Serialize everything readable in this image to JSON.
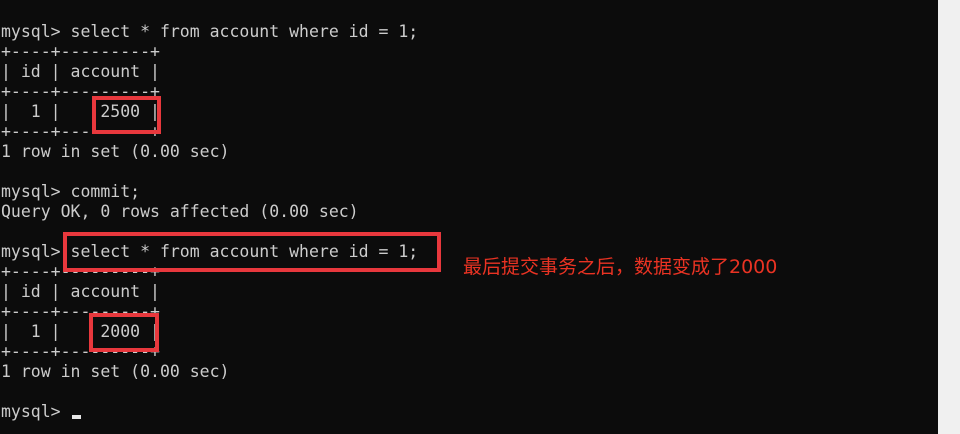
{
  "terminal": {
    "lines": [
      "mysql> select * from account where id = 1;",
      "+----+---------+",
      "| id | account |",
      "+----+---------+",
      "|  1 |    2500 |",
      "+----+---------+",
      "1 row in set (0.00 sec)",
      "",
      "mysql> commit;",
      "Query OK, 0 rows affected (0.00 sec)",
      "",
      "mysql> select * from account where id = 1;",
      "+----+---------+",
      "| id | account |",
      "+----+---------+",
      "|  1 |    2000 |",
      "+----+---------+",
      "1 row in set (0.00 sec)",
      "",
      "mysql> "
    ]
  },
  "annotation": {
    "text": "最后提交事务之后，数据变成了2000",
    "color": "#ea3323"
  },
  "highlight_color": "#e8383d",
  "scrollbar_color": "#f0f0f0"
}
